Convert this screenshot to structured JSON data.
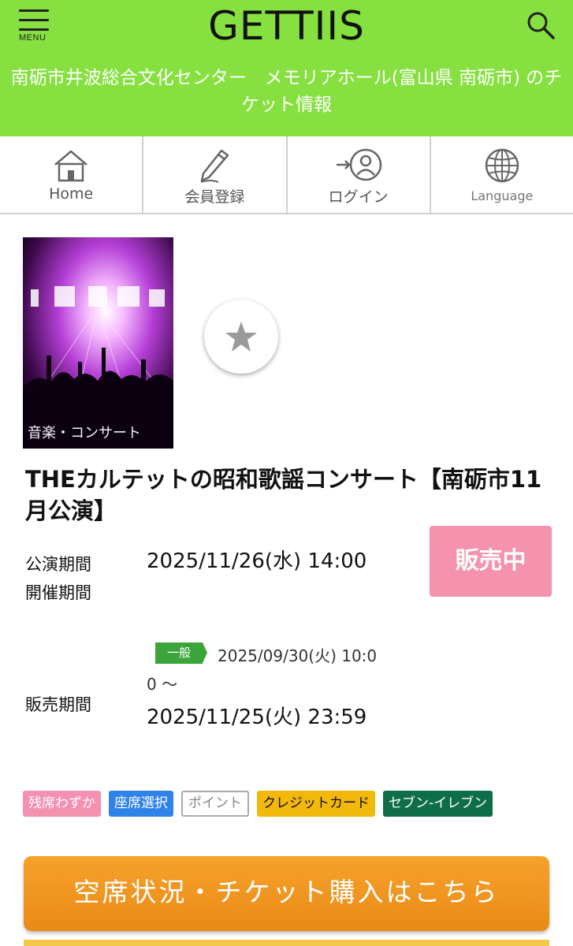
{
  "header": {
    "menu_label": "MENU",
    "logo": "GETTIIS",
    "title": "南砺市井波総合文化センター　メモリアホール(富山県 南砺市) のチケット情報",
    "bg_color": "#86e040"
  },
  "nav": {
    "home": "Home",
    "register": "会員登録",
    "login": "ログイン",
    "language": "Language"
  },
  "event": {
    "category": "音楽・コンサート",
    "title": "THEカルテットの昭和歌謡コンサート【南砺市11月公演】",
    "performance_label_1": "公演期間",
    "performance_label_2": "開催期間",
    "performance_date": "2025/11/26(水) 14:00",
    "status": "販売中",
    "sale_label": "販売期間",
    "sale_type": "一般",
    "sale_start": "2025/09/30(火) 10:00 〜",
    "sale_end": "2025/11/25(火) 23:59"
  },
  "tags": {
    "few_left": "残席わずか",
    "seat_select": "座席選択",
    "points": "ポイント",
    "credit_card": "クレジットカード",
    "seven_eleven": "セブン-イレブン"
  },
  "buy_button": "空席状況・チケット購入はこちら"
}
